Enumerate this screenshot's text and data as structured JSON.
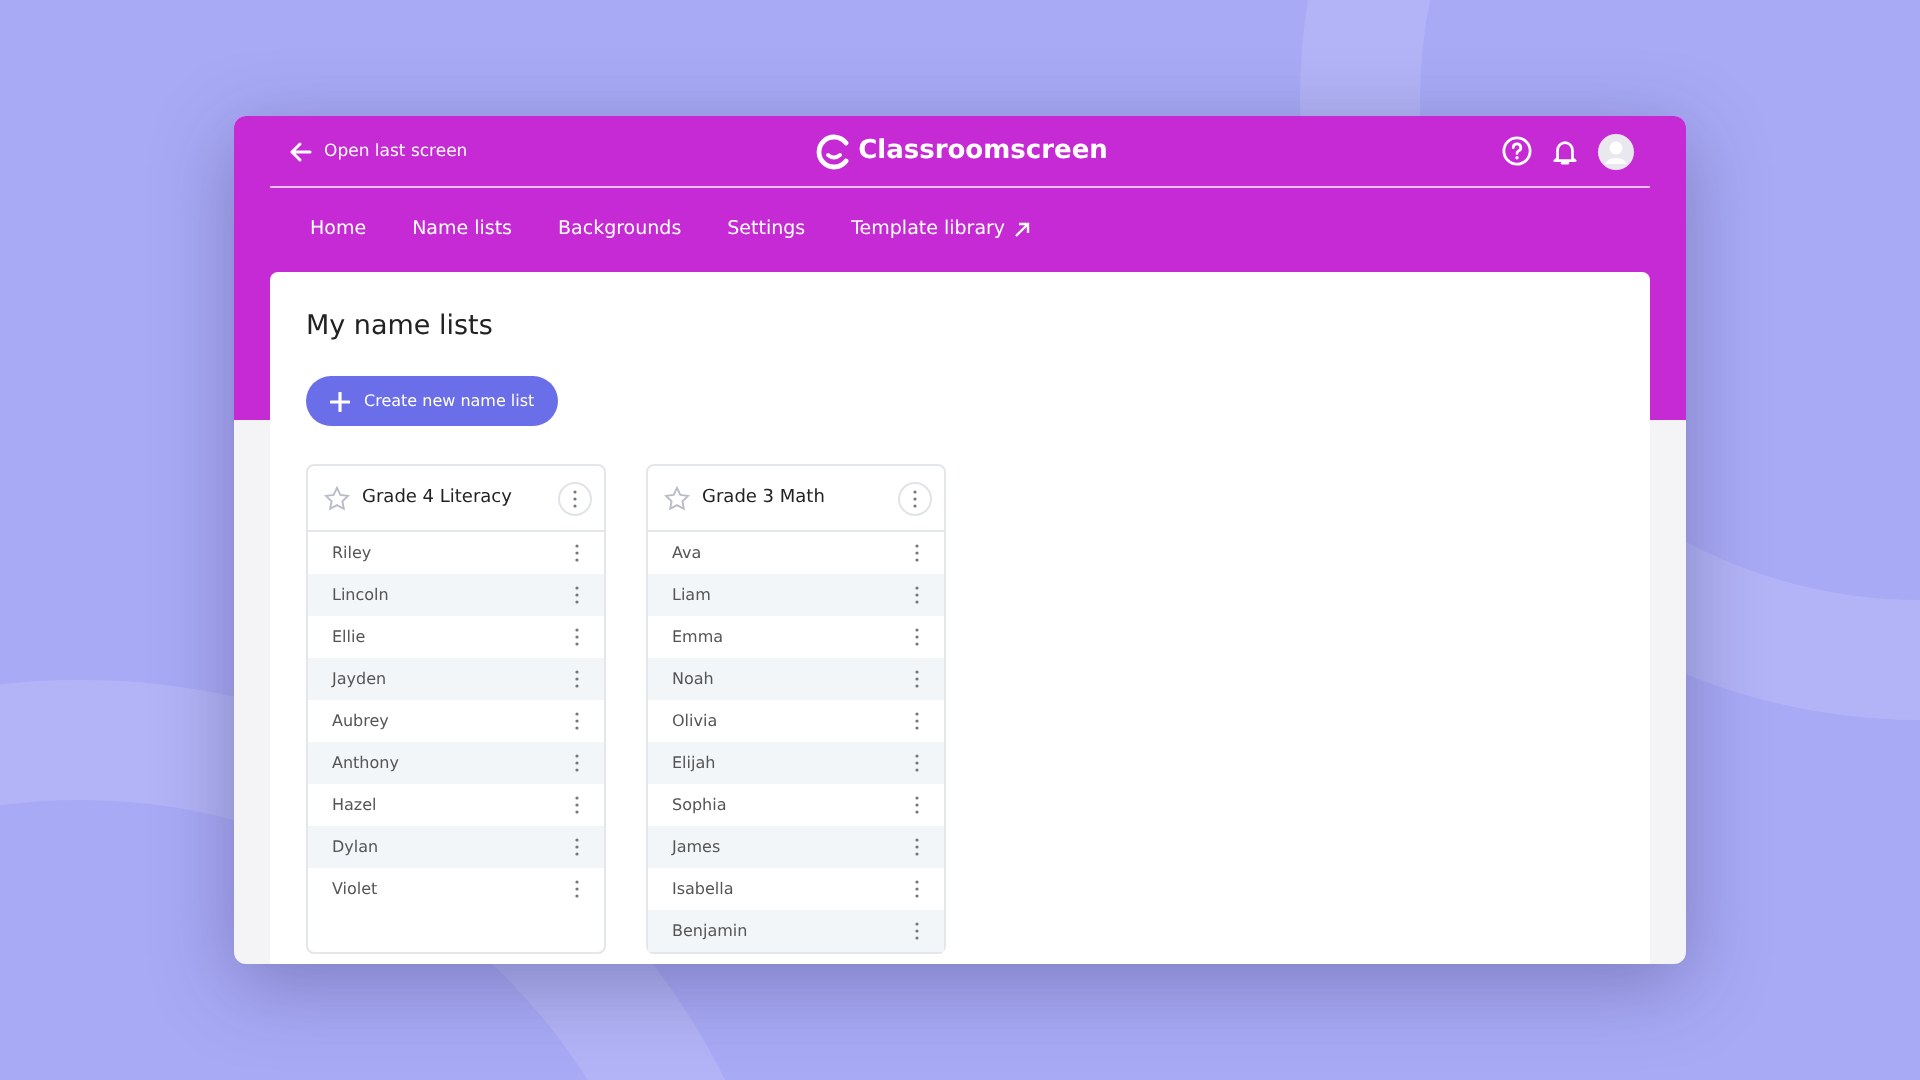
{
  "header": {
    "back_link": "Open last screen",
    "logo_text": "Classroomscreen"
  },
  "nav": [
    {
      "label": "Home",
      "external": false
    },
    {
      "label": "Name lists",
      "external": false
    },
    {
      "label": "Backgrounds",
      "external": false
    },
    {
      "label": "Settings",
      "external": false
    },
    {
      "label": "Template library",
      "external": true
    }
  ],
  "page": {
    "title": "My name lists",
    "create_button": "Create new name list"
  },
  "lists": [
    {
      "title": "Grade 4 Literacy",
      "starred": false,
      "names": [
        "Riley",
        "Lincoln",
        "Ellie",
        "Jayden",
        "Aubrey",
        "Anthony",
        "Hazel",
        "Dylan",
        "Violet"
      ]
    },
    {
      "title": "Grade 3 Math",
      "starred": false,
      "names": [
        "Ava",
        "Liam",
        "Emma",
        "Noah",
        "Olivia",
        "Elijah",
        "Sophia",
        "James",
        "Isabella",
        "Benjamin"
      ]
    }
  ]
}
